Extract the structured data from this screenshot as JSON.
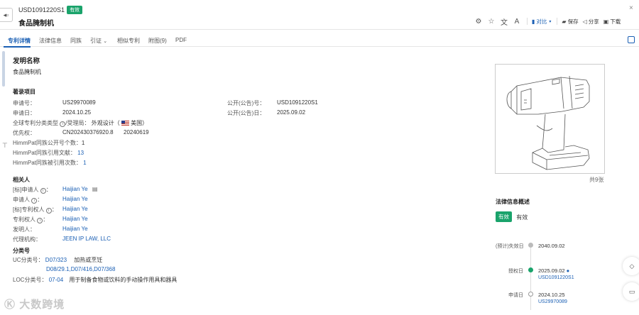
{
  "header": {
    "patent_number": "USD1091220S1",
    "status_badge": "有效",
    "title": "食品腌制机",
    "close": "×"
  },
  "toolbar": {
    "compare": "对比",
    "save": "保存",
    "share": "分享",
    "download": "下载"
  },
  "tabs": [
    "专利详情",
    "法律信息",
    "同族",
    "引证",
    "相似专利",
    "附图(9)",
    "PDF"
  ],
  "invention": {
    "section_title": "发明名称",
    "name": "食品腌制机"
  },
  "biblio": {
    "title": "著录项目",
    "application_no_label": "申请号：",
    "application_no": "US29970089",
    "pub_no_label": "公开(公告)号：",
    "pub_no": "USD1091220S1",
    "application_date_label": "申请日：",
    "application_date": "2024.10.25",
    "pub_date_label": "公开(公告)日：",
    "pub_date": "2025.09.02",
    "type_label": "全球专利分类类型",
    "authority_label": "/受理局：",
    "type_value": "外观设计（",
    "country": "美国",
    "type_close": "）",
    "priority_label": "优先权：",
    "priority_no": "CN202430376920.8",
    "priority_date": "20240619",
    "family_pub_label": "HimmPat同族公开号个数：",
    "family_pub": "1",
    "family_cite_label": "HimmPat同族引用文献：",
    "family_cite": "13",
    "family_cited_label": "HimmPat同族被引用次数：",
    "family_cited": "1"
  },
  "related": {
    "title": "相关人",
    "std_applicant_label": "[标]申请人",
    "std_applicant": "Haijian Ye",
    "applicant_label": "申请人",
    "applicant": "Haijian Ye",
    "std_owner_label": "[标]专利权人",
    "std_owner": "Haijian Ye",
    "owner_label": "专利权人",
    "owner": "Haijian Ye",
    "inventor_label": "发明人：",
    "inventor": "Haijian Ye",
    "agency_label": "代理机构：",
    "agency": "JEEN IP LAW, LLC"
  },
  "classification": {
    "title": "分类号",
    "uc_label": "UC分类号：",
    "uc_main": "D07/323",
    "uc_desc": "加热或烹饪",
    "uc_more": "D08/29.1,D07/416,D07/368",
    "loc_label": "LOC分类号：",
    "loc_code": "07-04",
    "loc_desc": "用于制备食物或饮料的手动操作用具和器具"
  },
  "image_panel": {
    "count": "共9张"
  },
  "legal": {
    "title": "法律信息概述",
    "badge": "有效",
    "status": "有效",
    "timeline": [
      {
        "label": "(预计)失效日",
        "date": "2040.09.02",
        "link": ""
      },
      {
        "label": "授权日",
        "date": "2025.09.02",
        "link": "USD1091220S1"
      },
      {
        "label": "申请日",
        "date": "2024.10.25",
        "link": "US29970089"
      }
    ]
  },
  "watermark": "大数跨境",
  "colors": {
    "primary": "#1a5fb4",
    "valid_green": "#1aa36b"
  }
}
